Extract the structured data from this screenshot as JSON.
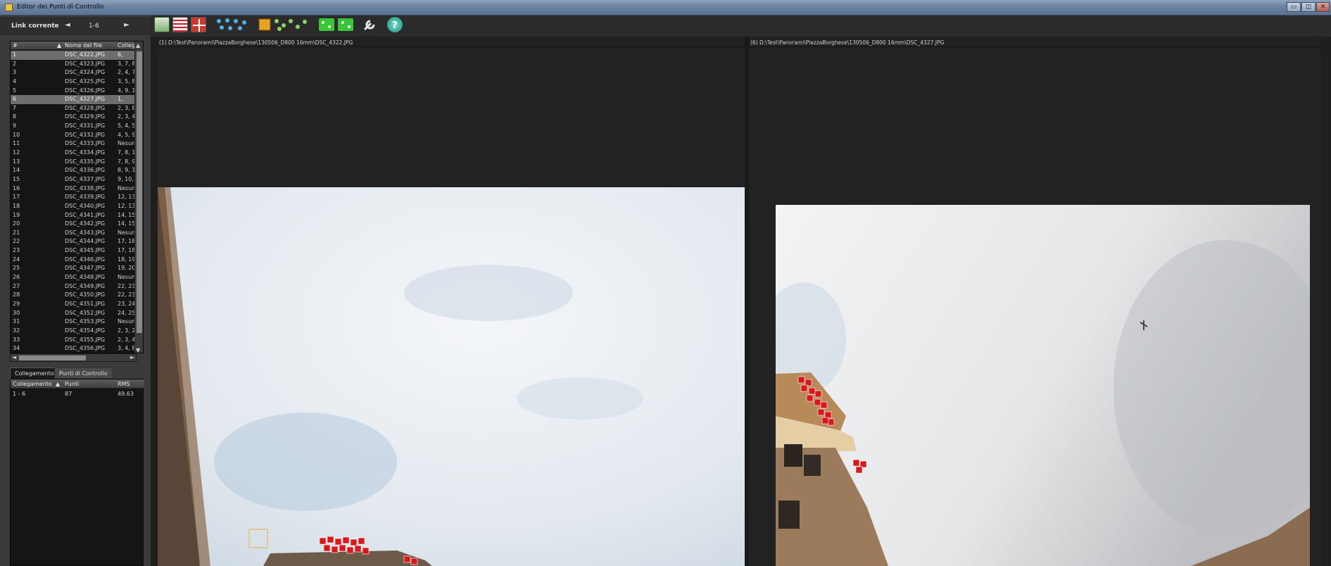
{
  "window": {
    "title": "Editor dei Punti di Controllo",
    "controls": {
      "minimize": "▭",
      "restore": "◫",
      "close": "✕"
    }
  },
  "nav": {
    "label": "Link corrente",
    "prev": "◄",
    "range": "1-6",
    "next": "►"
  },
  "toolbar": {
    "icons": [
      "add-point-icon",
      "grid-lines-icon",
      "cross-lines-icon",
      "points-blue-icon",
      "points-yellow-icon",
      "points-green-icon",
      "wrench-icon",
      "help-icon"
    ]
  },
  "file_list": {
    "columns": {
      "index": "#",
      "sort": "▲",
      "name": "Nome del file",
      "links": "Colleg▲"
    },
    "rows": [
      {
        "idx": "1",
        "name": "DSC_4322.JPG",
        "links": "6,",
        "selected": true
      },
      {
        "idx": "2",
        "name": "DSC_4323.JPG",
        "links": "3, 7, 8,",
        "selected": false
      },
      {
        "idx": "3",
        "name": "DSC_4324.JPG",
        "links": "2, 4, 7,",
        "selected": false
      },
      {
        "idx": "4",
        "name": "DSC_4325.JPG",
        "links": "3, 5, 8,",
        "selected": false
      },
      {
        "idx": "5",
        "name": "DSC_4326.JPG",
        "links": "4, 9, 10",
        "selected": false
      },
      {
        "idx": "6",
        "name": "DSC_4327.JPG",
        "links": "1,",
        "selected": true
      },
      {
        "idx": "7",
        "name": "DSC_4328.JPG",
        "links": "2, 3, 8,",
        "selected": false
      },
      {
        "idx": "8",
        "name": "DSC_4329.JPG",
        "links": "2, 3, 4,",
        "selected": false
      },
      {
        "idx": "9",
        "name": "DSC_4331.JPG",
        "links": "5, 4, 5,",
        "selected": false
      },
      {
        "idx": "10",
        "name": "DSC_4332.JPG",
        "links": "4, 5, 9,",
        "selected": false
      },
      {
        "idx": "11",
        "name": "DSC_4333.JPG",
        "links": "Nesun",
        "selected": false
      },
      {
        "idx": "12",
        "name": "DSC_4334.JPG",
        "links": "7, 8, 13",
        "selected": false
      },
      {
        "idx": "13",
        "name": "DSC_4335.JPG",
        "links": "7, 8, 9,",
        "selected": false
      },
      {
        "idx": "14",
        "name": "DSC_4336.JPG",
        "links": "8, 9, 1",
        "selected": false
      },
      {
        "idx": "15",
        "name": "DSC_4337.JPG",
        "links": "9, 10, 1",
        "selected": false
      },
      {
        "idx": "16",
        "name": "DSC_4338.JPG",
        "links": "Nesun",
        "selected": false
      },
      {
        "idx": "17",
        "name": "DSC_4339.JPG",
        "links": "12, 13,",
        "selected": false
      },
      {
        "idx": "18",
        "name": "DSC_4340.JPG",
        "links": "12, 13,",
        "selected": false
      },
      {
        "idx": "19",
        "name": "DSC_4341.JPG",
        "links": "14, 15,",
        "selected": false
      },
      {
        "idx": "20",
        "name": "DSC_4342.JPG",
        "links": "14, 15,",
        "selected": false
      },
      {
        "idx": "21",
        "name": "DSC_4343.JPG",
        "links": "Nesun",
        "selected": false
      },
      {
        "idx": "22",
        "name": "DSC_4344.JPG",
        "links": "17, 18,",
        "selected": false
      },
      {
        "idx": "23",
        "name": "DSC_4345.JPG",
        "links": "17, 18,",
        "selected": false
      },
      {
        "idx": "24",
        "name": "DSC_4346.JPG",
        "links": "18, 19,",
        "selected": false
      },
      {
        "idx": "25",
        "name": "DSC_4347.JPG",
        "links": "19, 20,",
        "selected": false
      },
      {
        "idx": "26",
        "name": "DSC_4348.JPG",
        "links": "Nesun",
        "selected": false
      },
      {
        "idx": "27",
        "name": "DSC_4349.JPG",
        "links": "22, 23,",
        "selected": false
      },
      {
        "idx": "28",
        "name": "DSC_4350.JPG",
        "links": "22, 23,",
        "selected": false
      },
      {
        "idx": "29",
        "name": "DSC_4351.JPG",
        "links": "23, 24,",
        "selected": false
      },
      {
        "idx": "30",
        "name": "DSC_4352.JPG",
        "links": "24, 25,",
        "selected": false
      },
      {
        "idx": "31",
        "name": "DSC_4353.JPG",
        "links": "Nesun",
        "selected": false
      },
      {
        "idx": "32",
        "name": "DSC_4354.JPG",
        "links": "2, 3, 27",
        "selected": false
      },
      {
        "idx": "33",
        "name": "DSC_4355.JPG",
        "links": "2, 3, 4,",
        "selected": false
      },
      {
        "idx": "34",
        "name": "DSC_4356.JPG",
        "links": "3, 4, 8,",
        "selected": false
      }
    ]
  },
  "tabs": {
    "links": "Collegamento",
    "points": "Punti di Controllo"
  },
  "link_table": {
    "columns": {
      "link": "Collegamento",
      "sort": "▲",
      "points": "Punti",
      "rms": "RMS"
    },
    "rows": [
      {
        "link": "1 - 6",
        "points": "87",
        "rms": "49.63"
      }
    ]
  },
  "left_pane": {
    "path": "(1) D:\\Test\\Panorami\\PiazzaBorghese\\130506_D800 16mm\\DSC_4322.JPG"
  },
  "right_pane": {
    "path": "(6) D:\\Test\\Panorami\\PiazzaBorghese\\130506_D800 16mm\\DSC_4327.JPG"
  }
}
